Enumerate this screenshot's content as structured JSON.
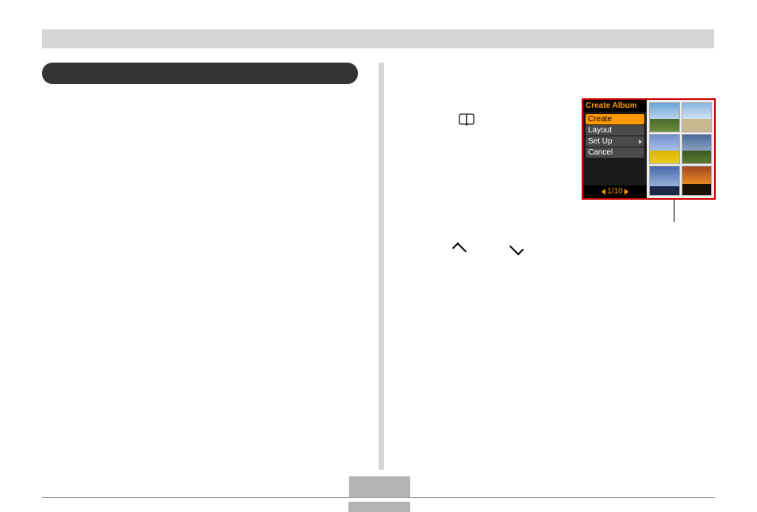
{
  "lcd": {
    "title": "Create Album",
    "menu": [
      {
        "label": "Create",
        "selected": true,
        "arrow": false
      },
      {
        "label": "Layout",
        "selected": false,
        "arrow": false
      },
      {
        "label": "Set Up",
        "selected": false,
        "arrow": true
      },
      {
        "label": "Cancel",
        "selected": false,
        "arrow": false
      }
    ],
    "pager": "1/10"
  }
}
